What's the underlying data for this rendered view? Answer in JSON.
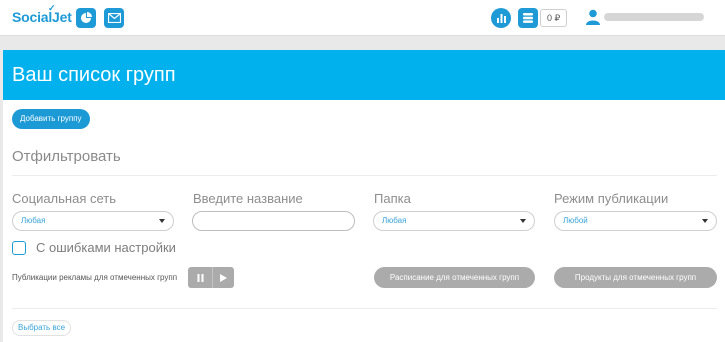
{
  "header": {
    "logo": "SocialJet",
    "balance": "0 ₽"
  },
  "page": {
    "title": "Ваш список групп",
    "add_group_label": "Добавить группу",
    "filter_title": "Отфильтровать"
  },
  "filters": {
    "network_label": "Социальная сеть",
    "network_value": "Любая",
    "name_label": "Введите название",
    "name_value": "",
    "folder_label": "Папка",
    "folder_value": "Любая",
    "mode_label": "Режим публикации",
    "mode_value": "Любой",
    "errors_label": "С ошибками настройки"
  },
  "actions": {
    "ads_label": "Публикации рекламы для отмеченных групп",
    "schedule_label": "Расписание для отмеченных групп",
    "products_label": "Продукты для отмеченных групп",
    "select_all_label": "Выбрать все"
  },
  "colors": {
    "accent": "#01b1ee",
    "brand": "#1e9ad6",
    "disabled": "#ababab"
  },
  "icons": [
    "pie-chart-icon",
    "mail-icon",
    "bar-chart-icon",
    "money-stack-icon",
    "user-icon",
    "pause-icon",
    "play-icon",
    "chevron-down-icon"
  ]
}
